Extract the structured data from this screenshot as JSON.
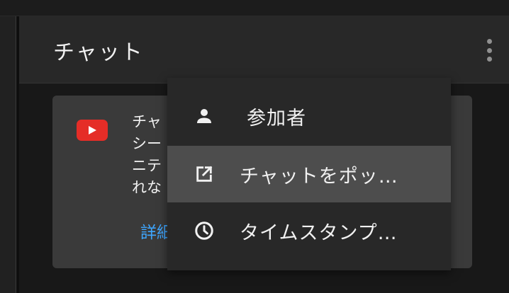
{
  "chat": {
    "title": "チャット"
  },
  "notice": {
    "lines": [
      "チャ",
      "シー",
      "ニテ",
      "れな"
    ],
    "link": "詳細"
  },
  "menu": {
    "items": [
      {
        "label": "参加者",
        "icon": "person-icon"
      },
      {
        "label": "チャットをポッ…",
        "icon": "open-in-new-icon",
        "active": true
      },
      {
        "label": "タイムスタンプ…",
        "icon": "clock-icon"
      }
    ]
  },
  "colors": {
    "background": "#0f0f0f",
    "header": "#282828",
    "card": "#3a3a3a",
    "menu": "#282828",
    "menu_active": "#4d4d4d",
    "youtube_red": "#e52d27",
    "link_blue": "#3ea6ff"
  }
}
